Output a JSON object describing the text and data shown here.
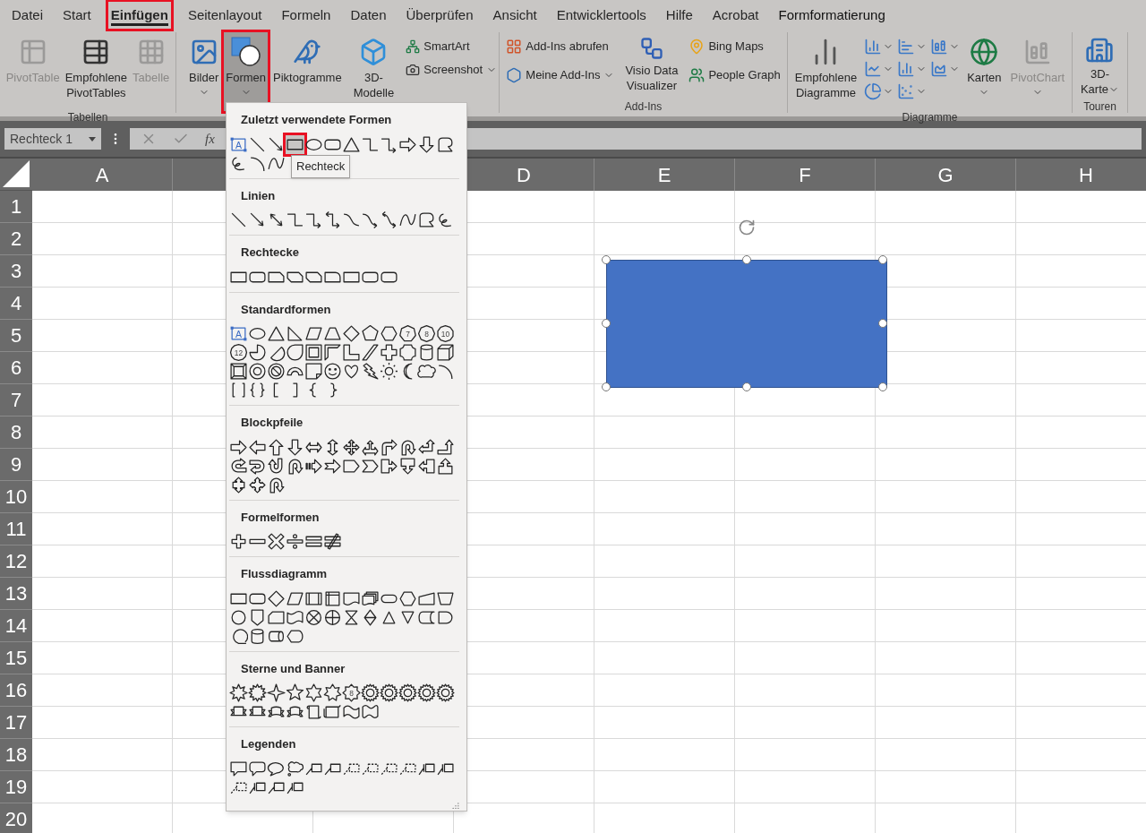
{
  "ribbon_tabs": [
    {
      "label": "Datei",
      "selected": false,
      "annotated": false,
      "kind": "normal"
    },
    {
      "label": "Start",
      "selected": false,
      "annotated": false,
      "kind": "normal"
    },
    {
      "label": "Einfügen",
      "selected": true,
      "annotated": true,
      "kind": "normal"
    },
    {
      "label": "Seitenlayout",
      "selected": false,
      "annotated": false,
      "kind": "normal"
    },
    {
      "label": "Formeln",
      "selected": false,
      "annotated": false,
      "kind": "normal"
    },
    {
      "label": "Daten",
      "selected": false,
      "annotated": false,
      "kind": "normal"
    },
    {
      "label": "Überprüfen",
      "selected": false,
      "annotated": false,
      "kind": "normal"
    },
    {
      "label": "Ansicht",
      "selected": false,
      "annotated": false,
      "kind": "normal"
    },
    {
      "label": "Entwicklertools",
      "selected": false,
      "annotated": false,
      "kind": "normal"
    },
    {
      "label": "Hilfe",
      "selected": false,
      "annotated": false,
      "kind": "normal"
    },
    {
      "label": "Acrobat",
      "selected": false,
      "annotated": false,
      "kind": "normal"
    },
    {
      "label": "Formformatierung",
      "selected": false,
      "annotated": false,
      "kind": "contextual"
    }
  ],
  "ribbon_groups": [
    {
      "label": "Tabellen",
      "buttons": [
        {
          "label_lines": [
            "PivotTable"
          ],
          "disabled": true
        },
        {
          "label_lines": [
            "Empfohlene",
            "PivotTables"
          ],
          "disabled": false
        },
        {
          "label_lines": [
            "Tabelle"
          ],
          "disabled": true
        }
      ]
    },
    {
      "buttons": [
        {
          "label_lines": [
            "Bilder"
          ]
        },
        {
          "label_lines": [
            "Formen"
          ],
          "pressed": true,
          "annotated": true
        },
        {
          "label_lines": [
            "Piktogramme"
          ]
        },
        {
          "label_lines": [
            "3D-",
            "Modelle"
          ]
        },
        {
          "label_lines": [
            "SmartArt"
          ]
        },
        {
          "label_lines": [
            "Screenshot"
          ]
        }
      ]
    },
    {
      "label": "Add-Ins",
      "buttons": [
        {
          "label_lines": [
            "Add-Ins abrufen"
          ]
        },
        {
          "label_lines": [
            "Meine Add-Ins"
          ]
        },
        {
          "label_lines": [
            "Visio Data",
            "Visualizer"
          ]
        },
        {
          "label_lines": [
            "Bing Maps"
          ]
        },
        {
          "label_lines": [
            "People Graph"
          ]
        }
      ]
    },
    {
      "label": "Diagramme",
      "buttons": [
        {
          "label_lines": [
            "Empfohlene",
            "Diagramme"
          ],
          "disabled": false
        },
        {
          "label_lines": [
            "Karten"
          ],
          "disabled": false
        },
        {
          "label_lines": [
            "PivotChart"
          ],
          "disabled": true
        }
      ]
    },
    {
      "label": "Touren",
      "buttons": [
        {
          "label_lines": [
            "3D-",
            "Karte"
          ]
        }
      ]
    }
  ],
  "formula_bar": {
    "name_box": "Rechteck 1",
    "function_label": "fx"
  },
  "column_headers": [
    "A",
    "D",
    "E",
    "F",
    "G",
    "H"
  ],
  "row_headers": [
    "1",
    "2",
    "3",
    "4",
    "5",
    "6",
    "7",
    "8",
    "9",
    "10",
    "11",
    "12",
    "13",
    "14",
    "15",
    "16",
    "17",
    "18",
    "19",
    "20"
  ],
  "canvas_shape": {
    "kind": "rectangle",
    "selected": true
  },
  "shape_menu": {
    "sections": [
      {
        "title": "Zuletzt verwendete Formen",
        "items": [
          {
            "kind": "textbox",
            "text": "A",
            "selected": false,
            "annotated": false
          },
          {
            "kind": "line",
            "selected": false,
            "annotated": false
          },
          {
            "kind": "arrow-line",
            "selected": false,
            "annotated": false
          },
          {
            "kind": "rectangle",
            "selected": true,
            "annotated": true
          },
          {
            "kind": "oval",
            "selected": false,
            "annotated": false
          },
          {
            "kind": "rounded-rectangle",
            "selected": false,
            "annotated": false
          },
          {
            "kind": "triangle",
            "selected": false,
            "annotated": false
          },
          {
            "kind": "elbow-connector",
            "selected": false,
            "annotated": false
          },
          {
            "kind": "elbow-arrow",
            "selected": false,
            "annotated": false
          },
          {
            "kind": "right-arrow",
            "selected": false,
            "annotated": false
          },
          {
            "kind": "down-arrow",
            "selected": false,
            "annotated": false
          },
          {
            "kind": "freeform",
            "selected": false,
            "annotated": false
          },
          {
            "kind": "scribble",
            "selected": false,
            "annotated": false
          },
          {
            "kind": "arc",
            "selected": false,
            "annotated": false
          },
          {
            "kind": "curve",
            "selected": false,
            "annotated": false
          }
        ]
      },
      {
        "title": "Linien"
      },
      {
        "title": "Rechtecke"
      },
      {
        "title": "Standardformen",
        "glyph_texts": [
          "A",
          "7",
          "8",
          "10",
          "12"
        ]
      },
      {
        "title": "Blockpfeile"
      },
      {
        "title": "Formelformen"
      },
      {
        "title": "Flussdiagramm"
      },
      {
        "title": "Sterne und Banner",
        "glyph_texts": [
          "8"
        ]
      },
      {
        "title": "Legenden"
      }
    ]
  },
  "tooltip": {
    "text": "Rechteck"
  }
}
